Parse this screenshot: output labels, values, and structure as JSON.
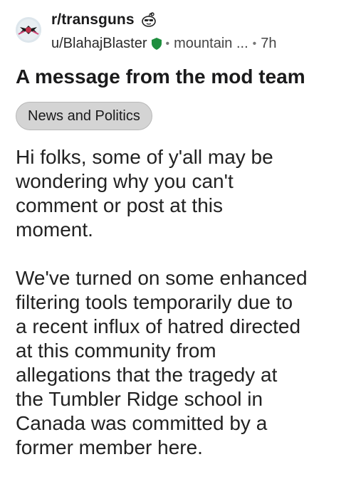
{
  "post": {
    "subreddit": "r/transguns",
    "username": "u/BlahajBlaster",
    "flair": "mountain ...",
    "age": "7h",
    "separator": "•",
    "title": "A message from the mod team",
    "tag": "News and Politics",
    "body": {
      "paragraph1": [
        "Hi folks, some of y'all may be",
        "wondering why you can't",
        "comment or post at this",
        "moment."
      ],
      "paragraph2": [
        "We've turned on some enhanced",
        "filtering tools temporarily due to",
        "a recent influx of hatred directed",
        "at this community from",
        "allegations that the tragedy at",
        "the Tumbler Ridge school in",
        "Canada was committed by a",
        "former member here."
      ]
    }
  },
  "icons": {
    "avatar": "subreddit-avatar-icon",
    "sub_badge": "mod-snoo-icon",
    "user_badge": "green-shield-icon"
  },
  "colors": {
    "shield": "#1e8e3e",
    "flair_bg": "#d4d4d4"
  }
}
